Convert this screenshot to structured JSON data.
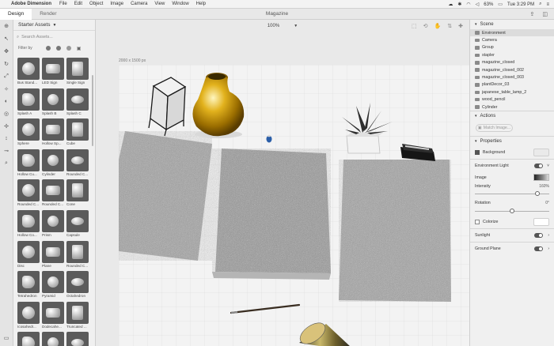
{
  "menubar": {
    "app_name": "Adobe Dimension",
    "items": [
      "File",
      "Edit",
      "Object",
      "Image",
      "Camera",
      "View",
      "Window",
      "Help"
    ],
    "battery": "63%",
    "clock": "Tue 3:29 PM"
  },
  "titlebar": {
    "tabs": [
      "Design",
      "Render"
    ],
    "document_title": "Magazine"
  },
  "assets": {
    "title": "Starter Assets",
    "search_placeholder": "Search Assets...",
    "filter_label": "Filter by",
    "items": [
      {
        "label": "Bus Stand...",
        "icon": "bus-stand-thumbnail"
      },
      {
        "label": "LED Sign",
        "icon": "led-sign-thumbnail"
      },
      {
        "label": "Single Sign",
        "icon": "single-sign-thumbnail"
      },
      {
        "label": "Splash A",
        "icon": "splash-thumbnail"
      },
      {
        "label": "Splash B",
        "icon": "splash-thumbnail"
      },
      {
        "label": "Splash C",
        "icon": "splash-thumbnail"
      },
      {
        "label": "Sphere",
        "icon": "sphere-thumbnail"
      },
      {
        "label": "Hollow Sp...",
        "icon": "hollow-sphere-thumbnail"
      },
      {
        "label": "Cube",
        "icon": "cube-thumbnail"
      },
      {
        "label": "Hollow Cu...",
        "icon": "hollow-cube-thumbnail"
      },
      {
        "label": "Cylinder",
        "icon": "cylinder-thumbnail"
      },
      {
        "label": "Rounded C...",
        "icon": "cone-thumbnail"
      },
      {
        "label": "Rounded C...",
        "icon": "rounded-cylinder-thumbnail"
      },
      {
        "label": "Rounded C...",
        "icon": "rounded-cube-thumbnail"
      },
      {
        "label": "Cone",
        "icon": "cone-thumbnail"
      },
      {
        "label": "Hollow Co...",
        "icon": "hollow-cone-thumbnail"
      },
      {
        "label": "Prism",
        "icon": "prism-thumbnail"
      },
      {
        "label": "Capsule",
        "icon": "capsule-thumbnail"
      },
      {
        "label": "Disc",
        "icon": "disc-thumbnail"
      },
      {
        "label": "Plane",
        "icon": "plane-thumbnail"
      },
      {
        "label": "Rounded C...",
        "icon": "rounded-plane-thumbnail"
      },
      {
        "label": "Tetrahedron",
        "icon": "tetrahedron-thumbnail"
      },
      {
        "label": "Pyramid",
        "icon": "pyramid-thumbnail"
      },
      {
        "label": "Octahedron",
        "icon": "octahedron-thumbnail"
      },
      {
        "label": "Icosahedr...",
        "icon": "icosahedron-thumbnail"
      },
      {
        "label": "Dodecahe...",
        "icon": "dodecahedron-thumbnail"
      },
      {
        "label": "Truncated ...",
        "icon": "truncated-thumbnail"
      },
      {
        "label": "",
        "icon": "shape-thumbnail"
      },
      {
        "label": "",
        "icon": "shape-thumbnail"
      },
      {
        "label": "",
        "icon": "shape-thumbnail"
      }
    ]
  },
  "canvas": {
    "zoom": "100%",
    "size_label": "2000 x 1500 px"
  },
  "scene_panel": {
    "title": "Scene",
    "items": [
      {
        "label": "Environment",
        "selected": true
      },
      {
        "label": "Camera",
        "selected": false
      },
      {
        "label": "Group",
        "selected": false
      },
      {
        "label": "stapler",
        "selected": false
      },
      {
        "label": "magazine_closed",
        "selected": false
      },
      {
        "label": "magazine_closed_002",
        "selected": false
      },
      {
        "label": "magazine_closed_003",
        "selected": false
      },
      {
        "label": "plantDecor_03",
        "selected": false
      },
      {
        "label": "japanese_table_lamp_2",
        "selected": false
      },
      {
        "label": "wood_pencil",
        "selected": false
      },
      {
        "label": "Cylinder",
        "selected": false
      }
    ]
  },
  "actions_panel": {
    "title": "Actions",
    "match_image": "Match Image..."
  },
  "properties_panel": {
    "title": "Properties",
    "background": "Background",
    "environment_light": "Environment Light",
    "image": "Image",
    "intensity": "Intensity",
    "intensity_value": "160%",
    "intensity_level": 0.84,
    "rotation": "Rotation",
    "rotation_value": "0°",
    "rotation_level": 0.5,
    "colorize": "Colorize",
    "sunlight": "Sunlight",
    "ground_plane": "Ground Plane"
  }
}
